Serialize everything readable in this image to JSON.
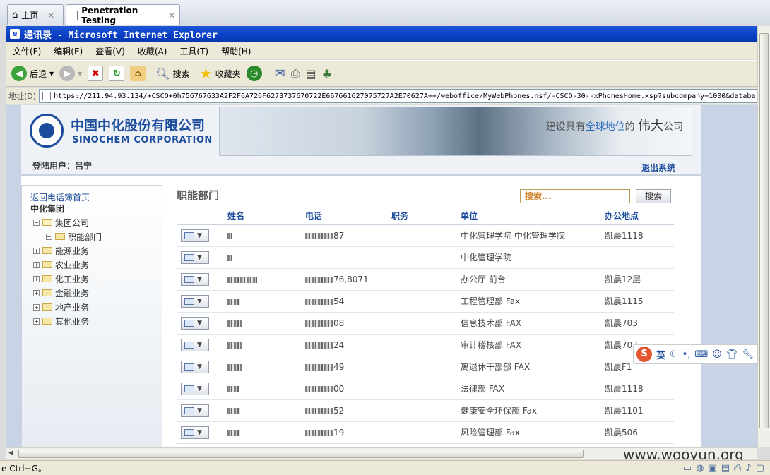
{
  "tabs": [
    {
      "label": "主页",
      "icon": "home-icon"
    },
    {
      "label": "Penetration Testing",
      "icon": "page-icon"
    }
  ],
  "window": {
    "title": "通讯录 - Microsoft Internet Explorer"
  },
  "menu": [
    "文件(F)",
    "编辑(E)",
    "查看(V)",
    "收藏(A)",
    "工具(T)",
    "帮助(H)"
  ],
  "toolbar": {
    "back": "后退",
    "search": "搜索",
    "favorites": "收藏夹"
  },
  "address": {
    "label": "地址(D)",
    "url": "https://211.94.93.134/+CSCO+0h756767633A2F2F6A726F6273737670722E667661627075727A2E70627A++/weboffice/MyWebPhones.nsf/-CSCO-30--xPhonesHome.xsp?subcompany=1000&databa"
  },
  "header": {
    "company_cn": "中国中化股份有限公司",
    "company_en": "SINOCHEM CORPORATION",
    "slogan_pre": "建设具有",
    "slogan_hl": "全球地位",
    "slogan_mid": "的",
    "slogan_big": "伟大",
    "slogan_end": "公司",
    "login_user": "登陆用户：吕宁",
    "logout": "退出系统"
  },
  "nav": {
    "back_link": "返回电话簿首页",
    "root": "中化集团",
    "items": [
      {
        "label": "集团公司",
        "level": 0,
        "expanded": true
      },
      {
        "label": "职能部门",
        "level": 1,
        "expanded": false
      },
      {
        "label": "能源业务",
        "level": 0,
        "expanded": false
      },
      {
        "label": "农业业务",
        "level": 0,
        "expanded": false
      },
      {
        "label": "化工业务",
        "level": 0,
        "expanded": false
      },
      {
        "label": "金融业务",
        "level": 0,
        "expanded": false
      },
      {
        "label": "地产业务",
        "level": 0,
        "expanded": false
      },
      {
        "label": "其他业务",
        "level": 0,
        "expanded": false
      }
    ]
  },
  "main": {
    "section_title": "职能部门",
    "search_placeholder": "搜索...",
    "search_button": "搜索",
    "columns": [
      "姓名",
      "电话",
      "职务",
      "单位",
      "办公地点"
    ],
    "rows": [
      {
        "phone_tail": "87",
        "unit": "中化管理学院  中化管理学院",
        "location": "凯晨1118"
      },
      {
        "phone_tail": "",
        "unit": "中化管理学院",
        "location": ""
      },
      {
        "phone_tail": "76,8071",
        "unit": "办公厅  前台",
        "location": "凯晨12层"
      },
      {
        "phone_tail": "54",
        "unit": "工程管理部  Fax",
        "location": "凯晨1115"
      },
      {
        "phone_tail": "08",
        "unit": "信息技术部  FAX",
        "location": "凯晨703"
      },
      {
        "phone_tail": "24",
        "unit": "审计稽核部  FAX",
        "location": "凯晨707"
      },
      {
        "phone_tail": "49",
        "unit": "离退休干部部  FAX",
        "location": "凯晨F1"
      },
      {
        "phone_tail": "00",
        "unit": "法律部  FAX",
        "location": "凯晨1118"
      },
      {
        "phone_tail": "52",
        "unit": "健康安全环保部  Fax",
        "location": "凯晨1101"
      },
      {
        "phone_tail": "19",
        "unit": "风险管理部  Fax",
        "location": "凯晨506"
      }
    ]
  },
  "ime": {
    "lang": "英"
  },
  "status": {
    "text": "e Ctrl+G。"
  },
  "watermark": "www.wooyun.org",
  "colors": {
    "ie_title": "#0a3fc4",
    "link": "#1c4c9c",
    "accent_orange": "#d0822b"
  }
}
